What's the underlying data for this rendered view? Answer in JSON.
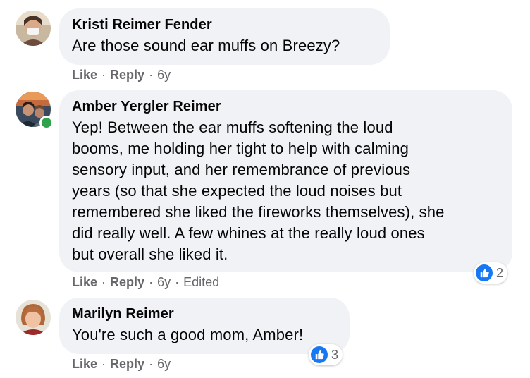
{
  "comments": [
    {
      "author": "Kristi Reimer Fender",
      "text": "Are those sound ear muffs on Breezy?",
      "actions": {
        "like": "Like",
        "reply": "Reply",
        "time": "6y",
        "edited": ""
      },
      "reaction_count": ""
    },
    {
      "author": "Amber Yergler Reimer",
      "text_lines": [
        "Yep! Between the ear muffs softening the loud",
        "booms, me holding her tight to help with calming",
        "sensory input, and her remembrance of previous",
        "years (so that she expected the loud noises but",
        "remembered she liked the fireworks themselves), she",
        "did really well. A few whines at the really loud ones",
        "but overall she liked it."
      ],
      "actions": {
        "like": "Like",
        "reply": "Reply",
        "time": "6y",
        "edited": "Edited"
      },
      "reaction_count": "2",
      "online": true
    },
    {
      "author": "Marilyn Reimer",
      "text": "You're such a good mom, Amber!",
      "actions": {
        "like": "Like",
        "reply": "Reply",
        "time": "6y",
        "edited": ""
      },
      "reaction_count": "3"
    }
  ],
  "separator": "·",
  "colors": {
    "bubble": "#f0f2f5",
    "meta": "#65676b",
    "like_blue": "#1877f2",
    "online": "#31a24c"
  },
  "icons": {
    "reaction": "thumbs-up-icon",
    "presence": "online-status-icon"
  }
}
